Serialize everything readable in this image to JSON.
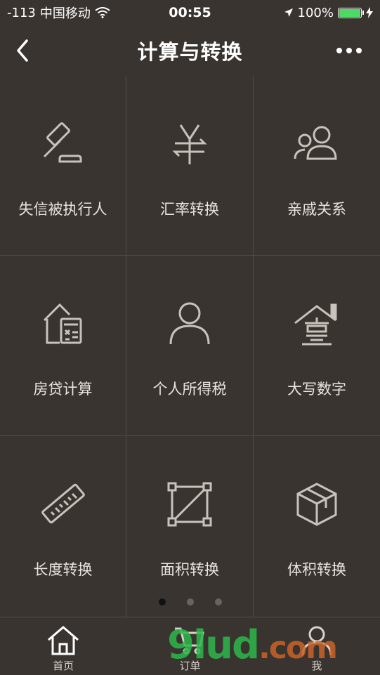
{
  "status": {
    "signal": "-113",
    "carrier": "中国移动",
    "time": "00:55",
    "battery": "100%"
  },
  "nav": {
    "title": "计算与转换"
  },
  "grid": [
    {
      "label": "失信被执行人",
      "icon": "gavel-icon"
    },
    {
      "label": "汇率转换",
      "icon": "currency-yen-icon"
    },
    {
      "label": "亲戚关系",
      "icon": "people-icon"
    },
    {
      "label": "房贷计算",
      "icon": "house-calculator-icon"
    },
    {
      "label": "个人所得税",
      "icon": "person-icon"
    },
    {
      "label": "大写数字",
      "icon": "house-chinese-numeral-icon"
    },
    {
      "label": "长度转换",
      "icon": "ruler-icon"
    },
    {
      "label": "面积转换",
      "icon": "area-square-icon"
    },
    {
      "label": "体积转换",
      "icon": "cube-icon"
    }
  ],
  "pager": {
    "pages": 3,
    "active": 1
  },
  "tabs": [
    {
      "label": "首页",
      "icon": "home-icon"
    },
    {
      "label": "订单",
      "icon": "cart-icon"
    },
    {
      "label": "我",
      "icon": "user-icon"
    }
  ],
  "watermark": {
    "text": "9lud",
    "suffix": ".com"
  }
}
